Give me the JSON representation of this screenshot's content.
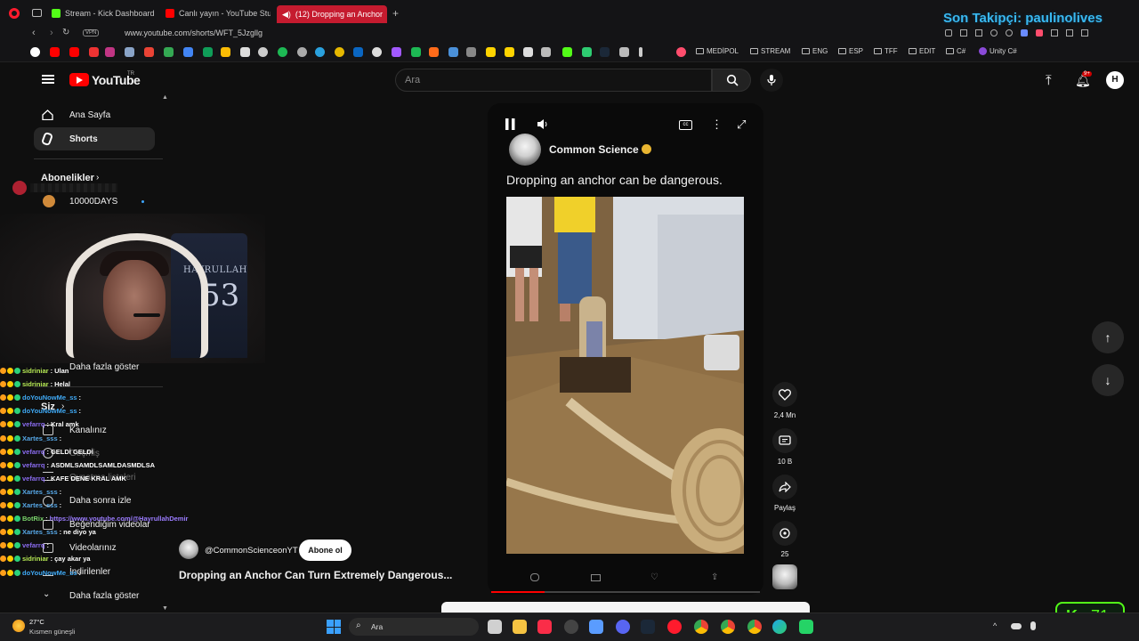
{
  "browser": {
    "tabs": [
      {
        "label": "Stream - Kick Dashboard",
        "favicon_color": "#53fc18"
      },
      {
        "label": "Canlı yayın - YouTube Stu",
        "favicon_color": "#ff0000"
      },
      {
        "label": "(12) Dropping an Anchor",
        "favicon_color": "#ffffff",
        "active": true
      }
    ],
    "vpn_label": "VPN",
    "url": "www.youtube.com/shorts/WFT_5Jzgllg",
    "bookmark_folders": [
      "MEDİPOL",
      "STREAM",
      "ENG",
      "ESP",
      "TFF",
      "EDIT",
      "C#",
      "Unity C#"
    ]
  },
  "overlay": {
    "follower_text": "Son Takipçi: paulinolives",
    "kick_viewers": "71",
    "jersey_name": "HAYRULLAH",
    "jersey_number": "53"
  },
  "youtube": {
    "logo_text": "YouTube",
    "region": "TR",
    "search_placeholder": "Ara",
    "notif_badge": "9+",
    "avatar_initial": "H",
    "sidebar": {
      "home": "Ana Sayfa",
      "shorts": "Shorts",
      "subscriptions_header": "Abonelikler",
      "sub_channel": "10000DAYS",
      "show_more": "Daha fazla göster",
      "you_header": "Siz",
      "your_channel": "Kanalınız",
      "history": "Geçmiş",
      "playlists": "Oynatma listeleri",
      "watch_later": "Daha sonra izle",
      "liked": "Beğendiğim videolar",
      "your_videos": "Videolarınız",
      "downloads": "İndirilenler",
      "show_more_2": "Daha fazla göster"
    },
    "short": {
      "channel": "Common Science",
      "caption": "Dropping an anchor can be dangerous.",
      "overlay_handle": "@CommonScienceonYT",
      "subscribe": "Abone ol",
      "title": "Dropping an Anchor Can Turn Extremely Dangerous...",
      "progress": 0.2
    },
    "actions": {
      "likes": "2,4 Mn",
      "comments": "10 B",
      "share": "Paylaş",
      "remix": "25"
    }
  },
  "chat": [
    {
      "user": "sidriniar",
      "color": "#b5e853",
      "msg": "Ulan"
    },
    {
      "user": "sidriniar",
      "color": "#b5e853",
      "msg": "Helal"
    },
    {
      "user": "doYouNowMe_ss",
      "color": "#3fa9f5",
      "msg": ""
    },
    {
      "user": "doYouNowMe_ss",
      "color": "#3fa9f5",
      "msg": ""
    },
    {
      "user": "vefarrq",
      "color": "#8a6cf0",
      "msg": "Kral amk"
    },
    {
      "user": "Xartes_sss",
      "color": "#57a8e8",
      "msg": ""
    },
    {
      "user": "vefarrq",
      "color": "#8a6cf0",
      "msg": "GELDİ GELDİ"
    },
    {
      "user": "vefarrq",
      "color": "#8a6cf0",
      "msg": "ASDMLSAMDLSAMLDASMDLSA"
    },
    {
      "user": "vefarrq",
      "color": "#8a6cf0",
      "msg": "KAFE DENE KRAL AMK"
    },
    {
      "user": "Xartes_sss",
      "color": "#57a8e8",
      "msg": ""
    },
    {
      "user": "Xartes_sss",
      "color": "#57a8e8",
      "msg": ""
    },
    {
      "user": "BotRix",
      "color": "#7ad36b",
      "msg": "https://www.youtube.com/@HayrullahDemir"
    },
    {
      "user": "Xartes_sss",
      "color": "#57a8e8",
      "msg": "ne diyo ya"
    },
    {
      "user": "vefarrq",
      "color": "#8a6cf0",
      "msg": ""
    },
    {
      "user": "sidriniar",
      "color": "#b5e853",
      "msg": "çay akar ya"
    },
    {
      "user": "doYouNowMe_ss",
      "color": "#3fa9f5",
      "msg": ""
    }
  ],
  "taskbar": {
    "temp": "27°C",
    "weather": "Kısmen güneşli",
    "search": "Ara"
  }
}
